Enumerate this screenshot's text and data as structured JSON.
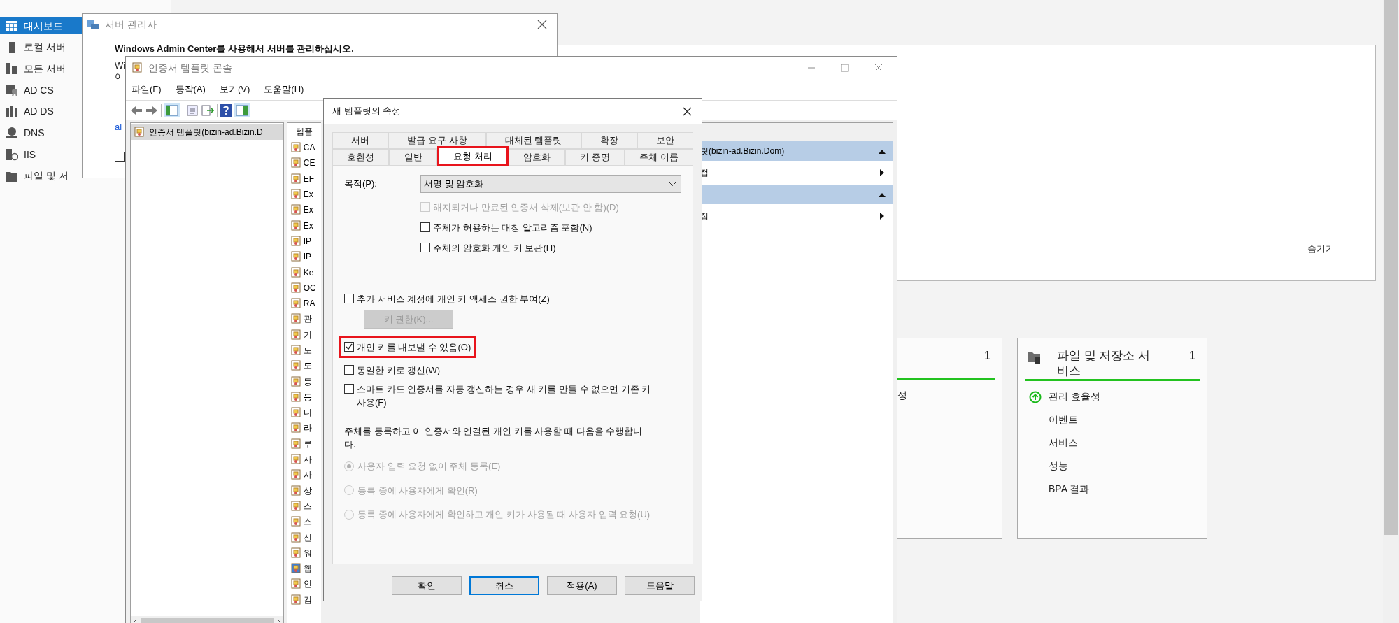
{
  "sidebar": {
    "items": [
      {
        "label": "대시보드",
        "selected": true
      },
      {
        "label": "로컬 서버",
        "selected": false
      },
      {
        "label": "모든 서버",
        "selected": false
      },
      {
        "label": "AD CS",
        "selected": false
      },
      {
        "label": "AD DS",
        "selected": false
      },
      {
        "label": "DNS",
        "selected": false
      },
      {
        "label": "IIS",
        "selected": false
      },
      {
        "label": "파일 및 저",
        "selected": false
      }
    ]
  },
  "welcome_panel": {
    "hide_link": "숨기기"
  },
  "tiles": [
    {
      "count": "1",
      "items": [
        {
          "label": "성"
        }
      ]
    },
    {
      "title": "파일 및 저장소 서비스",
      "count": "1",
      "items": [
        {
          "label": "관리 효율성",
          "kind": "status"
        },
        {
          "label": "이벤트",
          "kind": "link"
        },
        {
          "label": "서비스",
          "kind": "link"
        },
        {
          "label": "성능",
          "kind": "link"
        },
        {
          "label": "BPA 결과",
          "kind": "link"
        }
      ]
    }
  ],
  "server_manager_dialog": {
    "title": "서버 관리자",
    "heading": "Windows Admin Center를 사용해서 서버를 관리하십시오.",
    "lines": [
      "Wi",
      "이"
    ],
    "link": "al",
    "checkbox": {
      "checked": false
    }
  },
  "console": {
    "title": "인증서 템플릿 콘솔",
    "menu": [
      "파일(F)",
      "동작(A)",
      "보기(V)",
      "도움말(H)"
    ],
    "tree": [
      {
        "label": "인증서 템플릿(bizin-ad.Bizin.D",
        "selected": true
      }
    ],
    "list": {
      "column": "템플",
      "rows": [
        {
          "label": "CA",
          "selected": false
        },
        {
          "label": "CE",
          "selected": false
        },
        {
          "label": "EF",
          "selected": false
        },
        {
          "label": "Ex",
          "selected": false
        },
        {
          "label": "Ex",
          "selected": false
        },
        {
          "label": "Ex",
          "selected": false
        },
        {
          "label": "IP",
          "selected": false
        },
        {
          "label": "IP",
          "selected": false
        },
        {
          "label": "Ke",
          "selected": false
        },
        {
          "label": "OC",
          "selected": false
        },
        {
          "label": "RA",
          "selected": false
        },
        {
          "label": "관",
          "selected": false
        },
        {
          "label": "기",
          "selected": false
        },
        {
          "label": "도",
          "selected": false
        },
        {
          "label": "도",
          "selected": false
        },
        {
          "label": "등",
          "selected": false
        },
        {
          "label": "등",
          "selected": false
        },
        {
          "label": "디",
          "selected": false
        },
        {
          "label": "라",
          "selected": false
        },
        {
          "label": "루",
          "selected": false
        },
        {
          "label": "사",
          "selected": false
        },
        {
          "label": "사",
          "selected": false
        },
        {
          "label": "상",
          "selected": false
        },
        {
          "label": "스",
          "selected": false
        },
        {
          "label": "스",
          "selected": false
        },
        {
          "label": "신",
          "selected": false
        },
        {
          "label": "워",
          "selected": false
        },
        {
          "label": "웹",
          "selected": true
        },
        {
          "label": "인",
          "selected": false
        },
        {
          "label": "컴",
          "selected": false
        }
      ]
    },
    "actions": [
      {
        "kind": "header",
        "label": "릿(bizin-ad.Bizin.Dom)"
      },
      {
        "kind": "item",
        "label": "접"
      },
      {
        "kind": "header"
      },
      {
        "kind": "item",
        "label": "접"
      }
    ]
  },
  "dialog": {
    "title": "새 템플릿의 속성",
    "tab_rows": [
      [
        {
          "label": "서버",
          "selected": false
        },
        {
          "label": "발급 요구 사항",
          "selected": false
        },
        {
          "label": "대체된 템플릿",
          "selected": false
        },
        {
          "label": "확장",
          "selected": false
        },
        {
          "label": "보안",
          "selected": false
        }
      ],
      [
        {
          "label": "호환성",
          "selected": false
        },
        {
          "label": "일반",
          "selected": false
        },
        {
          "label": "요청 처리",
          "selected": true
        },
        {
          "label": "암호화",
          "selected": false
        },
        {
          "label": "키 증명",
          "selected": false
        },
        {
          "label": "주체 이름",
          "selected": false
        }
      ]
    ],
    "purpose": {
      "label": "목적(P):",
      "value": "서명 및 암호화"
    },
    "purpose_options": [
      {
        "label": "해지되거나 만료된 인증서 삭제(보관 안 함)(D)",
        "checked": false,
        "disabled": true
      },
      {
        "label": "주체가 허용하는 대칭 알고리즘 포함(N)",
        "checked": false,
        "disabled": false
      },
      {
        "label": "주체의 암호화 개인 키 보관(H)",
        "checked": false,
        "disabled": false
      }
    ],
    "key_access": {
      "label": "추가 서비스 계정에 개인 키 액세스 권한 부여(Z)",
      "checked": false,
      "disabled": false,
      "button": {
        "label": "키 권한(K)...",
        "disabled": true
      }
    },
    "key_options": [
      {
        "label": "개인 키를 내보낼 수 있음(O)",
        "checked": true,
        "disabled": false,
        "highlighted": true
      },
      {
        "label": "동일한 키로 갱신(W)",
        "checked": false,
        "disabled": false,
        "highlighted": false
      },
      {
        "label": "스마트 카드 인증서를 자동 갱신하는 경우 새 키를 만들 수 없으면 기존 키 사용(F)",
        "checked": false,
        "disabled": false,
        "highlighted": false
      }
    ],
    "enroll_prompt": "주체를 등록하고 이 인증서와 연결된 개인 키를 사용할 때 다음을 수행합니다.",
    "enroll_options": [
      {
        "label": "사용자 입력 요청 없이 주체 등록(E)",
        "selected": true,
        "disabled": true
      },
      {
        "label": "등록 중에 사용자에게 확인(R)",
        "selected": false,
        "disabled": true
      },
      {
        "label": "등록 중에 사용자에게 확인하고 개인 키가 사용될 때 사용자 입력 요청(U)",
        "selected": false,
        "disabled": true
      }
    ],
    "buttons": [
      {
        "label": "확인",
        "focused": false
      },
      {
        "label": "취소",
        "focused": true
      },
      {
        "label": "적용(A)",
        "focused": false
      },
      {
        "label": "도움말",
        "focused": false
      }
    ]
  }
}
